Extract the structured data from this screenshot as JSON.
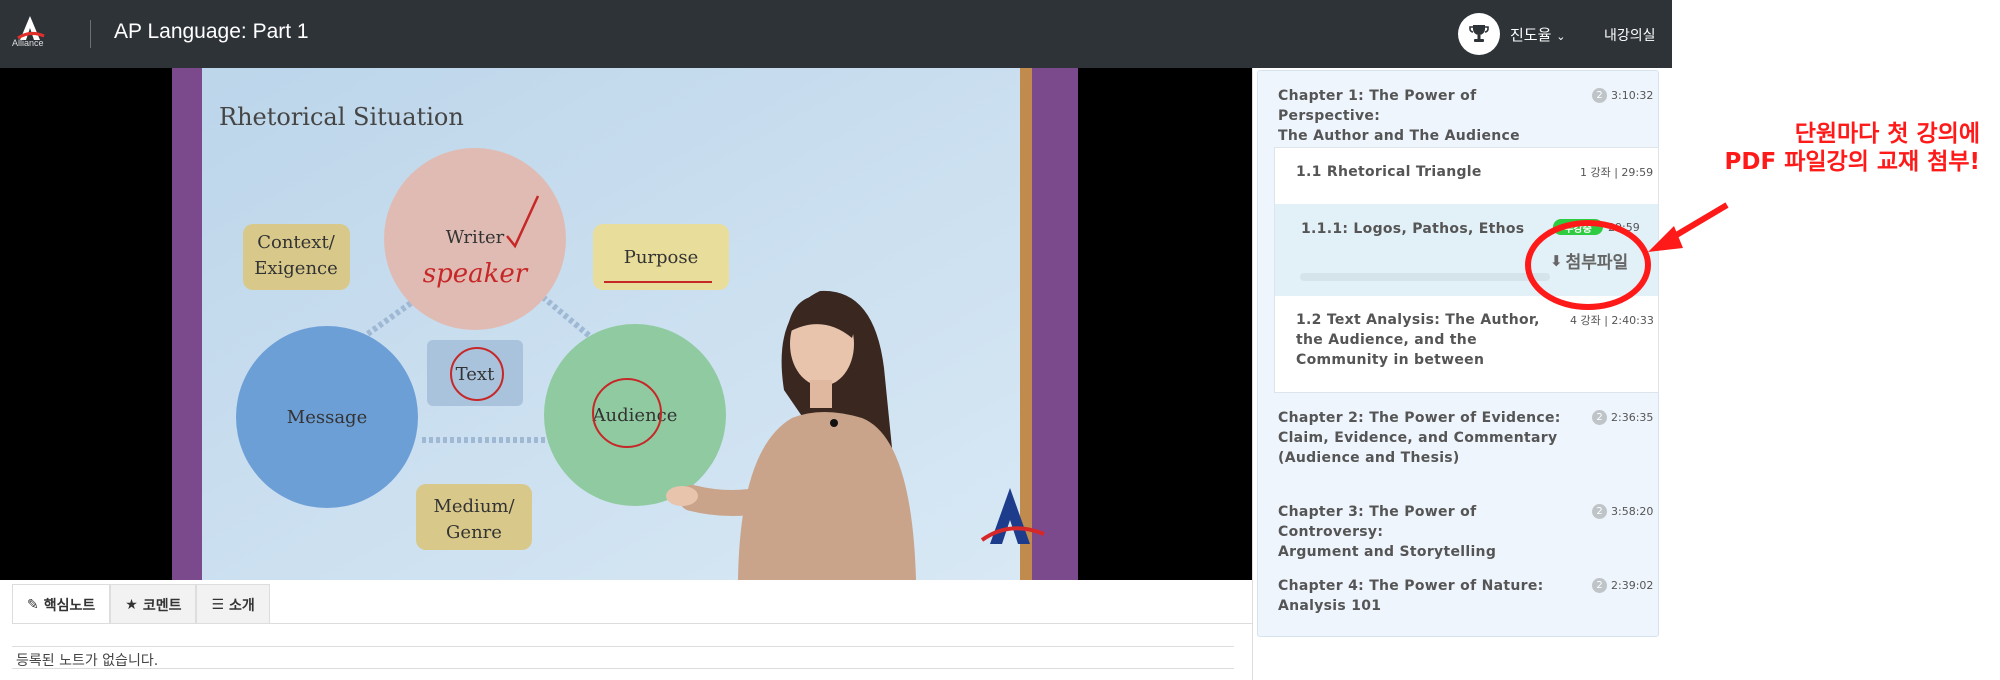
{
  "header": {
    "logo_text": "Alliance",
    "title": "AP Language: Part 1",
    "progress_label": "진도율",
    "classroom_label": "내강의실"
  },
  "slide": {
    "title": "Rhetorical Situation",
    "writer": "Writer",
    "speaker_note": "speaker",
    "purpose": "Purpose",
    "context": "Context/",
    "exigence": "Exigence",
    "text": "Text",
    "message": "Message",
    "audience": "Audience",
    "medium": "Medium/",
    "genre": "Genre"
  },
  "tabs": [
    {
      "label": "핵심노트",
      "icon": "edit-icon"
    },
    {
      "label": "코멘트",
      "icon": "star-icon"
    },
    {
      "label": "소개",
      "icon": "list-icon"
    }
  ],
  "notes": {
    "empty_message": "등록된 노트가 없습니다."
  },
  "sidebar": {
    "chapters": [
      {
        "title_line1": "Chapter 1: The Power of Perspective:",
        "title_line2": "The Author and The Audience",
        "title_line3": "",
        "count": "2",
        "duration": "3:10:32"
      },
      {
        "title_line1": "Chapter 2: The Power of Evidence:",
        "title_line2": "Claim, Evidence, and Commentary",
        "title_line3": "(Audience and Thesis)",
        "count": "2",
        "duration": "2:36:35"
      },
      {
        "title_line1": "Chapter 3: The Power of Controversy:",
        "title_line2": "Argument and Storytelling",
        "title_line3": "",
        "count": "2",
        "duration": "3:58:20"
      },
      {
        "title_line1": "Chapter 4: The Power of Nature:",
        "title_line2": "Analysis 101",
        "title_line3": "",
        "count": "2",
        "duration": "2:39:02"
      }
    ],
    "sections": [
      {
        "title_line1": "1.1 Rhetorical Triangle",
        "title_line2": "",
        "title_line3": "",
        "meta": "1 강좌 | 29:59"
      },
      {
        "title_line1": "1.2 Text Analysis: The Author,",
        "title_line2": "the Audience, and the",
        "title_line3": "Community in between",
        "meta": "4 강좌 | 2:40:33"
      }
    ],
    "active_lesson": {
      "title": "1.1.1: Logos, Pathos, Ethos",
      "status": "수강중",
      "duration": "29:59",
      "attachment_label": "첨부파일"
    }
  },
  "annotation": {
    "line1": "단원마다 첫 강의에",
    "line2": "PDF 파일강의 교재 첨부!",
    "color": "#ff1a1a"
  },
  "colors": {
    "header_bg": "#2e3338",
    "sidebar_bg": "#eef5fc",
    "active_lesson_bg": "#e2f0f7",
    "status_green": "#2ecc40"
  }
}
